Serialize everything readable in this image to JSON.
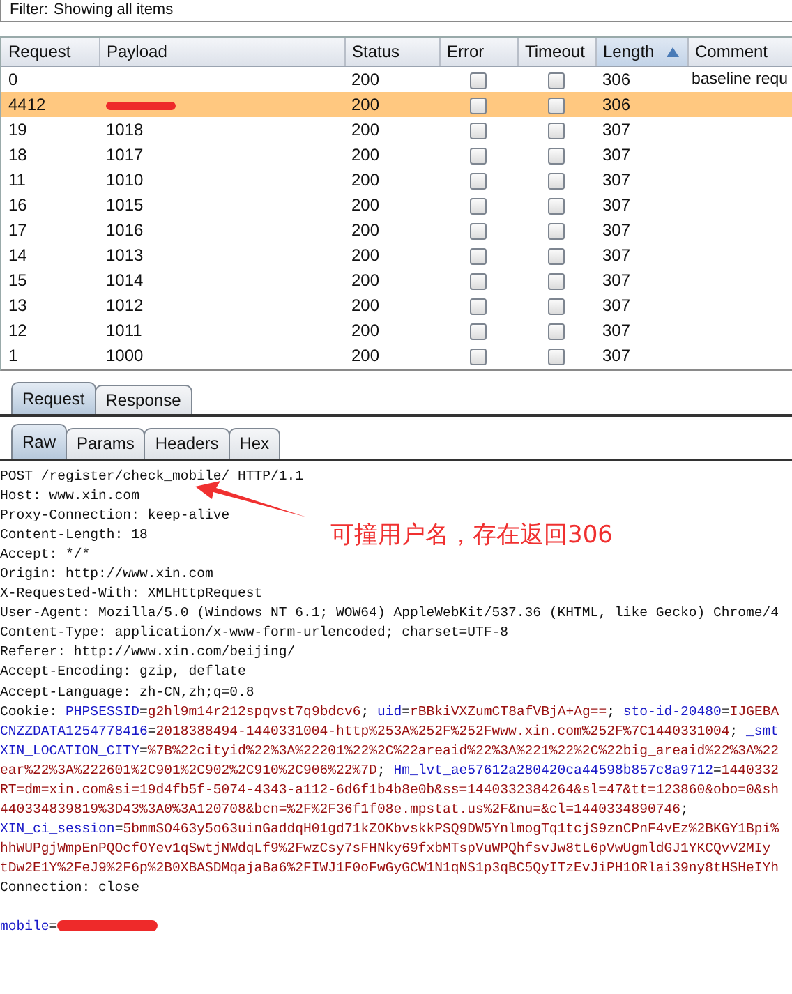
{
  "filter": {
    "label": "Filter:",
    "value": "Showing all items"
  },
  "table": {
    "columns": [
      {
        "label": "Request",
        "sorted": false
      },
      {
        "label": "Payload",
        "sorted": false
      },
      {
        "label": "Status",
        "sorted": false
      },
      {
        "label": "Error",
        "sorted": false
      },
      {
        "label": "Timeout",
        "sorted": false
      },
      {
        "label": "Length",
        "sorted": true
      },
      {
        "label": "Comment",
        "sorted": false
      }
    ],
    "rows": [
      {
        "request": "0",
        "redacted": false,
        "status": "200",
        "error": false,
        "timeout": false,
        "length": "306",
        "comment": "baseline requ",
        "selected": false
      },
      {
        "request": "4412",
        "redacted": true,
        "status": "200",
        "error": false,
        "timeout": false,
        "length": "306",
        "selected": true
      },
      {
        "request": "19",
        "payload": "1018",
        "redacted": false,
        "status": "200",
        "error": false,
        "timeout": false,
        "length": "307",
        "selected": false
      },
      {
        "request": "18",
        "payload": "1017",
        "redacted": false,
        "status": "200",
        "error": false,
        "timeout": false,
        "length": "307",
        "selected": false
      },
      {
        "request": "11",
        "payload": "1010",
        "redacted": false,
        "status": "200",
        "error": false,
        "timeout": false,
        "length": "307",
        "selected": false
      },
      {
        "request": "16",
        "payload": "1015",
        "redacted": false,
        "status": "200",
        "error": false,
        "timeout": false,
        "length": "307",
        "selected": false
      },
      {
        "request": "17",
        "payload": "1016",
        "redacted": false,
        "status": "200",
        "error": false,
        "timeout": false,
        "length": "307",
        "selected": false
      },
      {
        "request": "14",
        "payload": "1013",
        "redacted": false,
        "status": "200",
        "error": false,
        "timeout": false,
        "length": "307",
        "selected": false
      },
      {
        "request": "15",
        "payload": "1014",
        "redacted": false,
        "status": "200",
        "error": false,
        "timeout": false,
        "length": "307",
        "selected": false
      },
      {
        "request": "13",
        "payload": "1012",
        "redacted": false,
        "status": "200",
        "error": false,
        "timeout": false,
        "length": "307",
        "selected": false
      },
      {
        "request": "12",
        "payload": "1011",
        "redacted": false,
        "status": "200",
        "error": false,
        "timeout": false,
        "length": "307",
        "selected": false
      },
      {
        "request": "1",
        "payload": "1000",
        "redacted": false,
        "status": "200",
        "error": false,
        "timeout": false,
        "length": "307",
        "selected": false
      }
    ]
  },
  "tabs": [
    {
      "label": "Request",
      "selected": true
    },
    {
      "label": "Response",
      "selected": false
    }
  ],
  "subtabs": [
    {
      "label": "Raw",
      "selected": true
    },
    {
      "label": "Params",
      "selected": false
    },
    {
      "label": "Headers",
      "selected": false
    },
    {
      "label": "Hex",
      "selected": false
    }
  ],
  "raw_lines": [
    [
      {
        "kind": "plain",
        "text": "POST /register/check_mobile/ HTTP/1.1"
      }
    ],
    [
      {
        "kind": "plain",
        "text": "Host: www.xin.com"
      }
    ],
    [
      {
        "kind": "plain",
        "text": "Proxy-Connection: keep-alive"
      }
    ],
    [
      {
        "kind": "plain",
        "text": "Content-Length: 18"
      }
    ],
    [
      {
        "kind": "plain",
        "text": "Accept: */*"
      }
    ],
    [
      {
        "kind": "plain",
        "text": "Origin: http://www.xin.com"
      }
    ],
    [
      {
        "kind": "plain",
        "text": "X-Requested-With: XMLHttpRequest"
      }
    ],
    [
      {
        "kind": "plain",
        "text": "User-Agent: Mozilla/5.0 (Windows NT 6.1; WOW64) AppleWebKit/537.36 (KHTML, like Gecko) Chrome/4"
      }
    ],
    [
      {
        "kind": "plain",
        "text": "Content-Type: application/x-www-form-urlencoded; charset=UTF-8"
      }
    ],
    [
      {
        "kind": "plain",
        "text": "Referer: http://www.xin.com/beijing/"
      }
    ],
    [
      {
        "kind": "plain",
        "text": "Accept-Encoding: gzip, deflate"
      }
    ],
    [
      {
        "kind": "plain",
        "text": "Accept-Language: zh-CN,zh;q=0.8"
      }
    ],
    [
      {
        "kind": "plain",
        "text": "Cookie: "
      },
      {
        "kind": "name",
        "text": "PHPSESSID"
      },
      {
        "kind": "plain",
        "text": "="
      },
      {
        "kind": "value",
        "text": "g2hl9m14r212spqvst7q9bdcv6"
      },
      {
        "kind": "plain",
        "text": "; "
      },
      {
        "kind": "name",
        "text": "uid"
      },
      {
        "kind": "plain",
        "text": "="
      },
      {
        "kind": "value",
        "text": "rBBkiVXZumCT8afVBjA+Ag=="
      },
      {
        "kind": "plain",
        "text": "; "
      },
      {
        "kind": "name",
        "text": "sto-id-20480"
      },
      {
        "kind": "plain",
        "text": "="
      },
      {
        "kind": "value",
        "text": "IJGEBA"
      }
    ],
    [
      {
        "kind": "name",
        "text": "CNZZDATA1254778416"
      },
      {
        "kind": "plain",
        "text": "="
      },
      {
        "kind": "value",
        "text": "2018388494-1440331004-http%253A%252F%252Fwww.xin.com%252F%7C1440331004"
      },
      {
        "kind": "plain",
        "text": "; "
      },
      {
        "kind": "name",
        "text": "_smt"
      }
    ],
    [
      {
        "kind": "name",
        "text": "XIN_LOCATION_CITY"
      },
      {
        "kind": "plain",
        "text": "="
      },
      {
        "kind": "value",
        "text": "%7B%22cityid%22%3A%22201%22%2C%22areaid%22%3A%221%22%2C%22big_areaid%22%3A%22"
      }
    ],
    [
      {
        "kind": "value",
        "text": "ear%22%3A%222601%2C901%2C902%2C910%2C906%22%7D"
      },
      {
        "kind": "plain",
        "text": "; "
      },
      {
        "kind": "name",
        "text": "Hm_lvt_ae57612a280420ca44598b857c8a9712"
      },
      {
        "kind": "plain",
        "text": "="
      },
      {
        "kind": "value",
        "text": "1440332"
      }
    ],
    [
      {
        "kind": "value",
        "text": "RT=dm=xin.com&si=19d4fb5f-5074-4343-a112-6d6f1b4b8e0b&ss=1440332384264&sl=47&tt=123860&obo=0&sh"
      }
    ],
    [
      {
        "kind": "value",
        "text": "440334839819%3D43%3A0%3A120708&bcn=%2F%2F36f1f08e.mpstat.us%2F&nu=&cl=1440334890746"
      },
      {
        "kind": "plain",
        "text": ";"
      }
    ],
    [
      {
        "kind": "name",
        "text": "XIN_ci_session"
      },
      {
        "kind": "plain",
        "text": "="
      },
      {
        "kind": "value",
        "text": "5bmmSO463y5o63uinGaddqH01gd71kZOKbvskkPSQ9DW5YnlmogTq1tcjS9znCPnF4vEz%2BKGY1Bpi%"
      }
    ],
    [
      {
        "kind": "value",
        "text": "hhWUPgjWmpEnPQOcfOYev1qSwtjNWdqLf9%2FwzCsy7sFHNky69fxbMTspVuWPQhfsvJw8tL6pVwUgmldGJ1YKCQvV2MIy"
      }
    ],
    [
      {
        "kind": "value",
        "text": "tDw2E1Y%2FeJ9%2F6p%2B0XBASDMqajaBa6%2FIWJ1F0oFwGyGCW1N1qNS1p3qBC5QyITzEvJiPH1ORlai39ny8tHSHeIYh"
      }
    ],
    [
      {
        "kind": "plain",
        "text": "Connection: close"
      }
    ],
    [
      {
        "kind": "blank"
      }
    ],
    [
      {
        "kind": "name",
        "text": "mobile"
      },
      {
        "kind": "plain",
        "text": "="
      },
      {
        "kind": "redacted"
      }
    ]
  ],
  "annotation": {
    "text": "可撞用户名，存在返回306"
  }
}
